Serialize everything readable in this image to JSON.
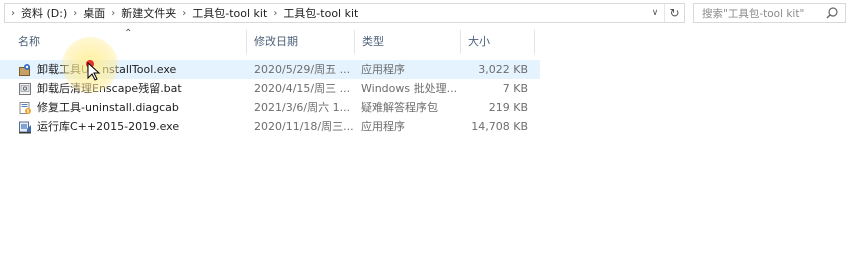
{
  "address": {
    "breadcrumbs": [
      "资料 (D:)",
      "桌面",
      "新建文件夹",
      "工具包-tool kit",
      "工具包-tool kit"
    ],
    "lead_icon": "chevron-right-icon"
  },
  "search": {
    "placeholder": "搜索\"工具包-tool kit\""
  },
  "columns": {
    "name": "名称",
    "date": "修改日期",
    "type": "类型",
    "size": "大小"
  },
  "files": [
    {
      "name": "卸载工具Uninstall Tool.exe",
      "name_visible": "卸载工具U",
      "name_tail": "nstallTool.exe",
      "date": "2020/5/29/周五 ...",
      "type": "应用程序",
      "size": "3,022 KB",
      "icon": "installer-icon"
    },
    {
      "name": "卸载后清理Enscape残留.bat",
      "date": "2020/4/15/周三 ...",
      "type": "Windows 批处理...",
      "size": "7 KB",
      "icon": "batch-file-icon"
    },
    {
      "name": "修复工具-uninstall.diagcab",
      "date": "2021/3/6/周六 1...",
      "type": "疑难解答程序包",
      "size": "219 KB",
      "icon": "diagcab-icon"
    },
    {
      "name": "运行库C++2015-2019.exe",
      "date": "2020/11/18/周三...",
      "type": "应用程序",
      "size": "14,708 KB",
      "icon": "setup-exe-icon"
    }
  ],
  "colors": {
    "hover_row": "#e5f3ff",
    "header_text": "#4c607a",
    "meta_text": "#6d6d6d"
  }
}
